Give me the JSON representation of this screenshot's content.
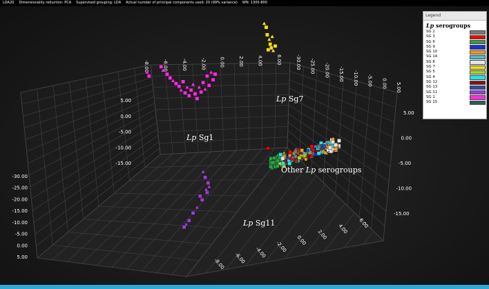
{
  "header": {
    "items": [
      "LDA20",
      "Dimensionality reduction: PCA",
      "Supervised grouping: LDA",
      "Actual number of principal components used: 20 (99% variance)",
      "WN: 1300-800"
    ]
  },
  "legend": {
    "header": "Legend",
    "title_italic": "Lp",
    "title_rest": " serogroups",
    "entries": [
      {
        "label": "SG 2",
        "color": "#7a7a7a"
      },
      {
        "label": "SG 3",
        "color": "#ff0000"
      },
      {
        "label": "SG 6",
        "color": "#2e9e4a"
      },
      {
        "label": "SG 9",
        "color": "#1f2fd6"
      },
      {
        "label": "SG 10",
        "color": "#f59a1e"
      },
      {
        "label": "SG 14",
        "color": "#49c1c9"
      },
      {
        "label": "SG 8",
        "color": "#e4e4e4"
      },
      {
        "label": "SG 7",
        "color": "#f3dc1d"
      },
      {
        "label": "SG 5",
        "color": "#a3d429"
      },
      {
        "label": "SG 4",
        "color": "#1ee6e6"
      },
      {
        "label": "SG 12",
        "color": "#8a0f12"
      },
      {
        "label": "SG 13",
        "color": "#2a4ea3"
      },
      {
        "label": "SG 11",
        "color": "#9b3ed6"
      },
      {
        "label": "SG 1",
        "color": "#ff2ce0"
      },
      {
        "label": "SG 15",
        "color": "#2f5a5a"
      }
    ]
  },
  "chart_data": {
    "type": "scatter",
    "projection": "3d",
    "grid": true,
    "legend_position": "top-right",
    "axes": {
      "top_ticks": [
        "-8.00",
        "-6.00",
        "-4.00",
        "-2.00",
        "0.00",
        "2.00",
        "4.00",
        "6.00"
      ],
      "right_top_ticks": [
        "-30.00",
        "-25.00",
        "-20.00",
        "-15.00",
        "-10.00",
        "-5.00",
        "0.00",
        "5.00"
      ],
      "left_upper_ticks": [
        "5.00",
        "0.00",
        "-5.00",
        "-10.00",
        "-15.00"
      ],
      "left_lower_ticks": [
        "-30.00",
        "-25.00",
        "-20.00",
        "-15.00",
        "-10.00",
        "-5.00",
        "0.00",
        "5.00"
      ],
      "right_side_ticks": [
        "5.00",
        "0.00",
        "-5.00",
        "-10.00",
        "-15.00"
      ],
      "bottom_ticks": [
        "-8.00",
        "-6.00",
        "-4.00",
        "-2.00",
        "0.00",
        "2.00",
        "4.00",
        "6.00"
      ]
    },
    "annotations": [
      {
        "italic": "Lp",
        "rest": " Sg7",
        "group": "SG 7"
      },
      {
        "italic": "Lp",
        "rest": " Sg1",
        "group": "SG 1"
      },
      {
        "italic": "",
        "rest": "Other ",
        "italic2": "Lp",
        "rest2": " serogroups",
        "group": "others"
      },
      {
        "italic": "Lp",
        "rest": " Sg11",
        "group": "SG 11"
      }
    ],
    "clusters": [
      {
        "group": "SG 1",
        "points": [
          [
            -7.8,
            0.6
          ],
          [
            -7.6,
            0.2
          ],
          [
            -6.4,
            1.2
          ],
          [
            -6.2,
            0.8
          ],
          [
            -5.8,
            0.4
          ],
          [
            -5.5,
            0.0
          ],
          [
            -5.2,
            -0.3
          ],
          [
            -4.9,
            -0.6
          ],
          [
            -4.6,
            -0.9
          ],
          [
            -4.4,
            -1.3
          ],
          [
            -4.2,
            -0.4
          ],
          [
            -4.0,
            -1.6
          ],
          [
            -3.8,
            -1.0
          ],
          [
            -3.6,
            -1.9
          ],
          [
            -3.4,
            -1.3
          ],
          [
            -3.2,
            -0.7
          ],
          [
            -3.0,
            -1.7
          ],
          [
            -2.8,
            -2.2
          ],
          [
            -2.6,
            -1.0
          ],
          [
            -2.4,
            -1.5
          ],
          [
            -2.2,
            -0.5
          ],
          [
            -2.0,
            -1.2
          ],
          [
            -1.8,
            0.2
          ],
          [
            -1.6,
            -0.8
          ],
          [
            -1.4,
            0.6
          ],
          [
            -1.2,
            -0.2
          ],
          [
            -1.0,
            0.4
          ]
        ]
      },
      {
        "group": "SG 7",
        "points": [
          [
            3.9,
            5.8
          ],
          [
            4.1,
            5.4
          ],
          [
            4.2,
            4.6
          ],
          [
            4.4,
            4.1
          ],
          [
            4.5,
            3.6
          ],
          [
            4.6,
            3.2
          ],
          [
            4.8,
            2.9
          ],
          [
            5.0,
            3.4
          ],
          [
            4.3,
            3.0
          ],
          [
            4.7,
            4.4
          ]
        ]
      },
      {
        "group": "SG 11",
        "points": [
          [
            -2.2,
            -10.0
          ],
          [
            -2.0,
            -10.6
          ],
          [
            -1.7,
            -11.2
          ],
          [
            -1.6,
            -11.6
          ],
          [
            -1.8,
            -12.2
          ],
          [
            -2.3,
            -13.0
          ],
          [
            -2.8,
            -13.8
          ],
          [
            -3.2,
            -14.4
          ],
          [
            -3.6,
            -15.2
          ],
          [
            -3.9,
            -15.6
          ],
          [
            -4.1,
            -15.9
          ],
          [
            -2.5,
            -12.6
          ],
          [
            -1.9,
            -11.9
          ]
        ]
      }
    ]
  }
}
